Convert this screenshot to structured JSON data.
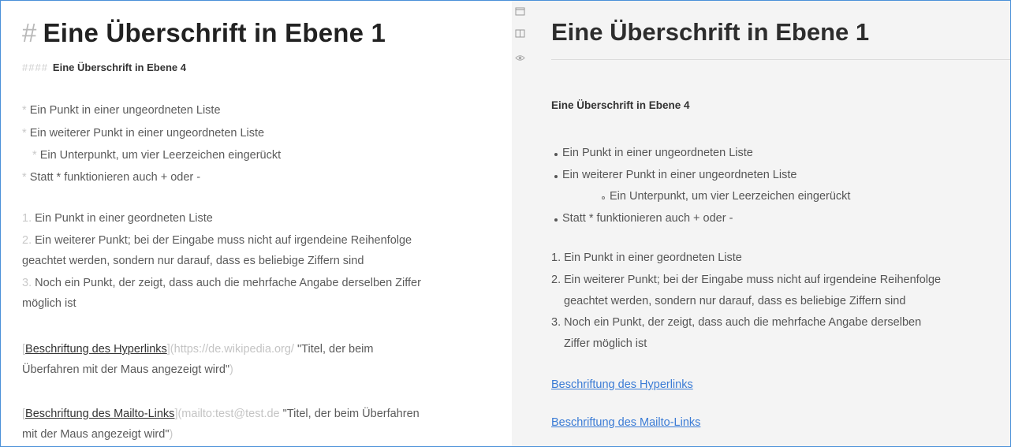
{
  "editor": {
    "h1_marker": "#",
    "h1_text": "Eine Überschrift in Ebene 1",
    "h4_marker": "####",
    "h4_text": "Eine Überschrift in Ebene 4",
    "bullet_marker": "*",
    "bullets": [
      "Ein Punkt in einer ungeordneten Liste",
      "Ein weiterer Punkt in einer ungeordneten Liste",
      "Ein Unterpunkt, um vier Leerzeichen eingerückt",
      "Statt * funktionieren auch + oder -"
    ],
    "ordered": [
      {
        "num": "1.",
        "lines": [
          "Ein Punkt in einer geordneten Liste"
        ]
      },
      {
        "num": "2.",
        "lines": [
          "Ein weiterer Punkt; bei der Eingabe muss nicht auf irgendeine Reihenfolge",
          "geachtet werden, sondern nur darauf, dass es beliebige Ziffern sind"
        ]
      },
      {
        "num": "3.",
        "lines": [
          "Noch ein Punkt, der zeigt, dass auch die mehrfache Angabe derselben Ziffer",
          "möglich ist"
        ]
      }
    ],
    "link1": {
      "open": "[",
      "text": "Beschriftung des Hyperlinks",
      "mid": "](",
      "url": "https://de.wikipedia.org/",
      "title": "\"Titel, der beim",
      "title_cont": "Überfahren mit der Maus angezeigt wird\"",
      "close": ")"
    },
    "link2": {
      "open": "[",
      "text": "Beschriftung des Mailto-Links",
      "mid": "](",
      "url": "mailto:test@test.de",
      "title": "\"Titel, der beim Überfahren",
      "title_cont": "mit der Maus angezeigt wird\"",
      "close": ")"
    }
  },
  "toolbar": {
    "icons": [
      "window-icon",
      "split-view-icon",
      "eye-icon"
    ]
  },
  "preview": {
    "h1": "Eine Überschrift in Ebene 1",
    "h4": "Eine Überschrift in Ebene 4",
    "bullets": [
      "Ein Punkt in einer ungeordneten Liste",
      "Ein weiterer Punkt in einer ungeordneten Liste"
    ],
    "sub_bullet": "Ein Unterpunkt, um vier Leerzeichen eingerückt",
    "bullet_last": "Statt * funktionieren auch + oder -",
    "ordered": [
      {
        "num": "1.",
        "lines": [
          "Ein Punkt in einer geordneten Liste"
        ]
      },
      {
        "num": "2.",
        "lines": [
          "Ein weiterer Punkt; bei der Eingabe muss nicht auf irgendeine Reihenfolge",
          "geachtet werden, sondern nur darauf, dass es beliebige Ziffern sind"
        ]
      },
      {
        "num": "3.",
        "lines": [
          "Noch ein Punkt, der zeigt, dass auch die mehrfache Angabe derselben",
          "Ziffer möglich ist"
        ]
      }
    ],
    "link1": "Beschriftung des Hyperlinks",
    "link2": "Beschriftung des Mailto-Links"
  },
  "colors": {
    "link": "#3a7bd5",
    "frame_border": "#4a90d9",
    "preview_bg": "#f4f4f4"
  }
}
